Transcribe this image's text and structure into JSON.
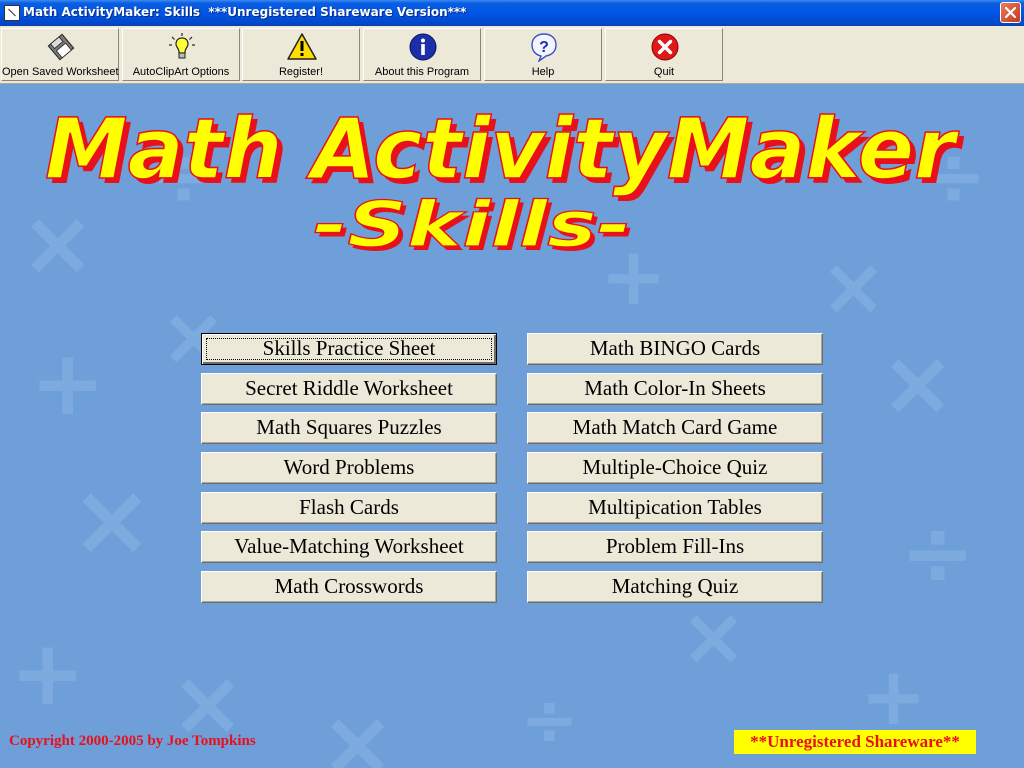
{
  "window": {
    "title": "Math ActivityMaker: Skills  ***Unregistered Shareware Version***"
  },
  "toolbar": {
    "buttons": [
      {
        "label": "Open Saved Worksheet",
        "icon": "floppy-disk-icon"
      },
      {
        "label": "AutoClipArt Options",
        "icon": "light-bulb-icon"
      },
      {
        "label": "Register!",
        "icon": "warning-icon"
      },
      {
        "label": "About this Program",
        "icon": "info-icon"
      },
      {
        "label": "Help",
        "icon": "help-icon"
      },
      {
        "label": "Quit",
        "icon": "quit-icon"
      }
    ]
  },
  "logo": {
    "line1": "Math ActivityMaker",
    "line2": "-Skills-"
  },
  "menu": {
    "left": [
      "Skills Practice Sheet",
      "Secret Riddle Worksheet",
      "Math Squares Puzzles",
      "Word Problems",
      "Flash Cards",
      "Value-Matching Worksheet",
      "Math Crosswords"
    ],
    "right": [
      "Math BINGO Cards",
      "Math Color-In Sheets",
      "Math Match Card Game",
      "Multiple-Choice Quiz",
      "Multipication Tables",
      "Problem Fill-Ins",
      "Matching Quiz"
    ]
  },
  "footer": {
    "copyright": "Copyright 2000-2005 by Joe Tompkins",
    "badge": "**Unregistered Shareware**"
  },
  "colors": {
    "background": "#6f9fd8",
    "logo_fill": "#ffff00",
    "logo_shadow": "#e8101a",
    "badge_bg": "#ffff00",
    "footer_text": "#e8101a"
  }
}
